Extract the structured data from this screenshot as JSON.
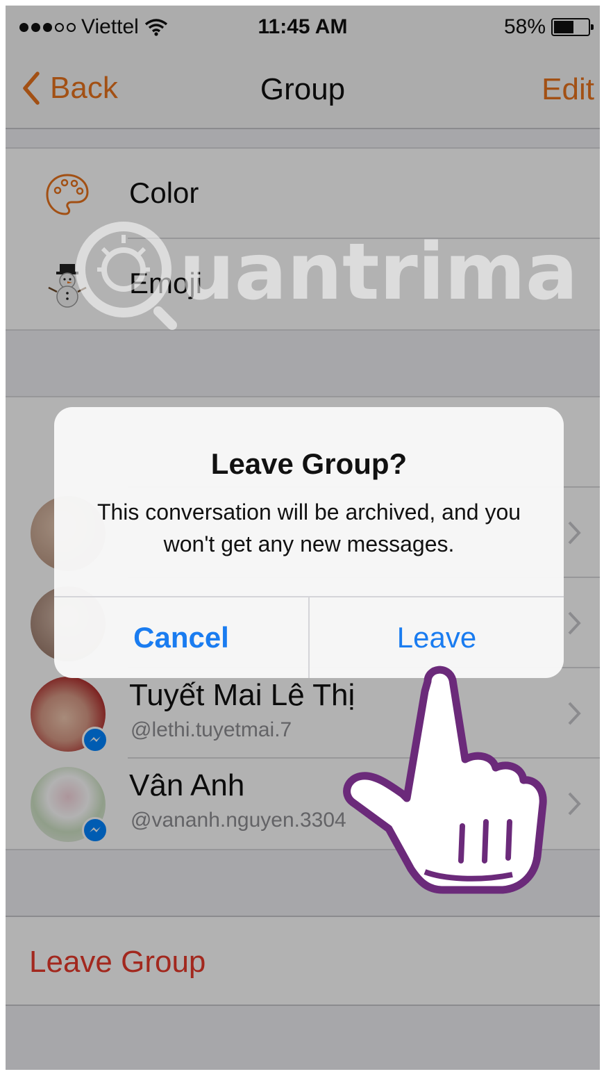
{
  "status_bar": {
    "carrier": "Viettel",
    "time": "11:45 AM",
    "battery_percent": "58%",
    "battery_level": 0.58,
    "signal_icon": "signal-dots-icon",
    "wifi_icon": "wifi-icon"
  },
  "nav": {
    "back_label": "Back",
    "title": "Group",
    "edit_label": "Edit"
  },
  "settings": {
    "items": [
      {
        "label": "Color",
        "icon": "palette-icon"
      },
      {
        "label": "Emoji",
        "icon": "snowman-emoji-icon"
      }
    ]
  },
  "members": [
    {
      "name": "Tuyết Mai Lê Thị",
      "handle": "@lethi.tuyetmai.7"
    },
    {
      "name": "Vân Anh",
      "handle": "@vananh.nguyen.3304"
    }
  ],
  "leave_group_label": "Leave Group",
  "alert": {
    "title": "Leave Group?",
    "message": "This conversation will be archived, and you won't get any new messages.",
    "cancel_label": "Cancel",
    "leave_label": "Leave"
  },
  "watermark": {
    "text": "uantrimang"
  },
  "colors": {
    "accent_orange": "#e8731d",
    "destructive_red": "#e83a2c",
    "alert_blue": "#1a7cf0",
    "messenger_blue": "#0084ff"
  }
}
